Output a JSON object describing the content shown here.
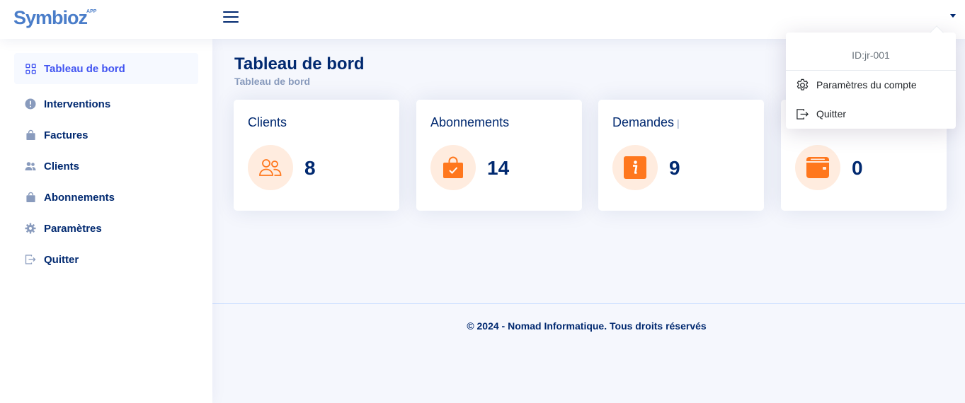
{
  "header": {
    "logo_text": "Symbioz",
    "logo_sup": "APP",
    "menu_icon": "hamburger-icon",
    "account_caret_icon": "caret-down-icon"
  },
  "sidebar": {
    "items": [
      {
        "label": "Tableau de bord",
        "icon": "grid-icon",
        "active": true
      },
      {
        "label": "Interventions",
        "icon": "exclamation-circle-icon"
      },
      {
        "label": "Factures",
        "icon": "bag-icon"
      },
      {
        "label": "Clients",
        "icon": "people-icon"
      },
      {
        "label": "Abonnements",
        "icon": "bag-icon"
      },
      {
        "label": "Paramètres",
        "icon": "gear-icon"
      },
      {
        "label": "Quitter",
        "icon": "logout-icon"
      }
    ]
  },
  "main": {
    "title": "Tableau de bord",
    "breadcrumb": "Tableau de bord",
    "cards": [
      {
        "title": "Clients",
        "value": "8",
        "icon": "people-icon"
      },
      {
        "title": "Abonnements",
        "value": "14",
        "icon": "bag-check-icon"
      },
      {
        "title": "Demandes",
        "pipe": "|",
        "value": "9",
        "icon": "info-square-icon"
      },
      {
        "title": "",
        "value": "0",
        "icon": "wallet-icon"
      }
    ]
  },
  "footer": {
    "text": "© 2024 - Nomad Informatique. Tous droits réservés"
  },
  "dropdown": {
    "user_id": "ID:jr-001",
    "items": [
      {
        "label": "Paramètres du compte",
        "icon": "gear-icon"
      },
      {
        "label": "Quitter",
        "icon": "logout-icon"
      }
    ]
  },
  "colors": {
    "primary": "#012970",
    "active": "#4154f1",
    "accent_orange": "#ff771d",
    "icon_bg": "#ffecdf",
    "page_bg": "#f5f7fd"
  }
}
